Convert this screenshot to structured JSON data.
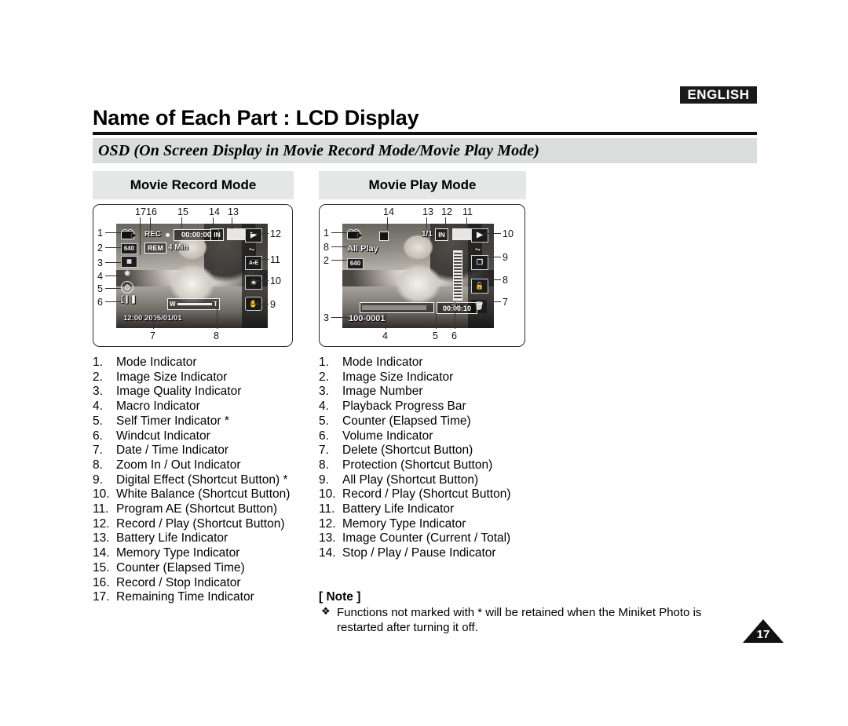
{
  "header": {
    "language_badge": "ENGLISH",
    "title": "Name of Each Part : LCD Display",
    "subtitle": "OSD (On Screen Display in Movie Record Mode/Movie Play Mode)"
  },
  "panels": {
    "record": {
      "tab_label": "Movie Record Mode",
      "osd": {
        "rec_label": "REC",
        "counter": "00:00:00",
        "rem_label": "REM",
        "rem_value": "4 Min",
        "image_size": "640",
        "memory_type": "IN",
        "datetime": "12:00  2005/01/01",
        "zoom_wide": "W",
        "zoom_tele": "T"
      },
      "callouts_top": [
        "17",
        "16",
        "15",
        "14",
        "13"
      ],
      "callouts_left": [
        "1",
        "2",
        "3",
        "4",
        "5",
        "6"
      ],
      "callouts_right": [
        "12",
        "11",
        "10",
        "9"
      ],
      "callouts_bottom": [
        "7",
        "8"
      ]
    },
    "play": {
      "tab_label": "Movie Play Mode",
      "osd": {
        "all_play": "All Play",
        "image_size": "640",
        "image_number": "100-0001",
        "counter": "00:00:10",
        "memory_type": "IN",
        "image_counter": "1/1"
      },
      "callouts_top": [
        "14",
        "13",
        "12",
        "11"
      ],
      "callouts_left": [
        "1",
        "8",
        "2",
        "3"
      ],
      "callouts_right": [
        "10",
        "9",
        "8",
        "7"
      ],
      "callouts_bottom": [
        "4",
        "5",
        "6"
      ]
    }
  },
  "legend_record": [
    {
      "index": "1.",
      "text": "Mode Indicator"
    },
    {
      "index": "2.",
      "text": "Image Size Indicator"
    },
    {
      "index": "3.",
      "text": "Image Quality Indicator"
    },
    {
      "index": "4.",
      "text": "Macro Indicator"
    },
    {
      "index": "5.",
      "text": "Self Timer Indicator *"
    },
    {
      "index": "6.",
      "text": "Windcut Indicator"
    },
    {
      "index": "7.",
      "text": "Date / Time Indicator"
    },
    {
      "index": "8.",
      "text": "Zoom In / Out Indicator"
    },
    {
      "index": "9.",
      "text": "Digital Effect (Shortcut Button) *"
    },
    {
      "index": "10.",
      "text": "White Balance (Shortcut Button)"
    },
    {
      "index": "11.",
      "text": "Program AE (Shortcut Button)"
    },
    {
      "index": "12.",
      "text": "Record / Play (Shortcut Button)"
    },
    {
      "index": "13.",
      "text": "Battery Life Indicator"
    },
    {
      "index": "14.",
      "text": "Memory Type Indicator"
    },
    {
      "index": "15.",
      "text": "Counter (Elapsed Time)"
    },
    {
      "index": "16.",
      "text": "Record / Stop Indicator"
    },
    {
      "index": "17.",
      "text": "Remaining Time Indicator"
    }
  ],
  "legend_play": [
    {
      "index": "1.",
      "text": "Mode Indicator"
    },
    {
      "index": "2.",
      "text": "Image Size Indicator"
    },
    {
      "index": "3.",
      "text": "Image Number"
    },
    {
      "index": "4.",
      "text": "Playback Progress Bar"
    },
    {
      "index": "5.",
      "text": "Counter (Elapsed Time)"
    },
    {
      "index": "6.",
      "text": "Volume Indicator"
    },
    {
      "index": "7.",
      "text": "Delete (Shortcut Button)"
    },
    {
      "index": "8.",
      "text": "Protection (Shortcut Button)"
    },
    {
      "index": "9.",
      "text": "All Play (Shortcut Button)"
    },
    {
      "index": "10.",
      "text": "Record / Play (Shortcut Button)"
    },
    {
      "index": "11.",
      "text": "Battery Life Indicator"
    },
    {
      "index": "12.",
      "text": "Memory Type Indicator"
    },
    {
      "index": "13.",
      "text": "Image Counter (Current / Total)"
    },
    {
      "index": "14.",
      "text": "Stop / Play / Pause Indicator"
    }
  ],
  "note": {
    "title": "[ Note ]",
    "bullet": "❖",
    "body": "Functions not marked with * will be retained when the Miniket Photo is restarted after turning it off."
  },
  "footer": {
    "page_number": "17"
  }
}
